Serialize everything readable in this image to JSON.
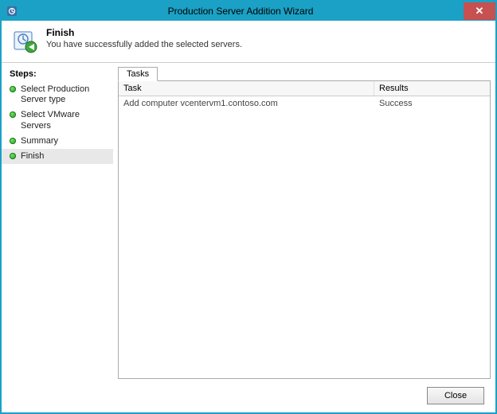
{
  "window": {
    "title": "Production Server Addition Wizard",
    "close_glyph": "✕"
  },
  "header": {
    "title": "Finish",
    "subtitle": "You have successfully added the selected servers."
  },
  "steps": {
    "heading": "Steps:",
    "items": [
      {
        "label": "Select Production Server type"
      },
      {
        "label": "Select VMware Servers"
      },
      {
        "label": "Summary"
      },
      {
        "label": "Finish",
        "current": true
      }
    ]
  },
  "tasks_tab": {
    "label": "Tasks",
    "columns": {
      "task": "Task",
      "results": "Results"
    },
    "rows": [
      {
        "task": "Add computer  vcentervm1.contoso.com",
        "results": "Success"
      }
    ]
  },
  "footer": {
    "close_label": "Close"
  }
}
